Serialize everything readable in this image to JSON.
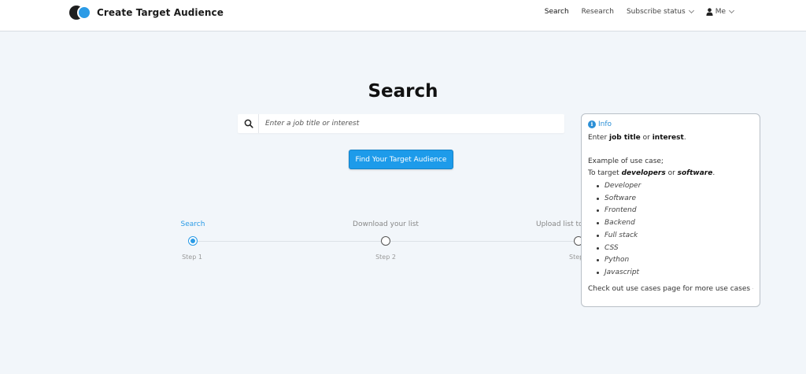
{
  "header": {
    "app_title": "Create Target Audience",
    "nav": {
      "search": "Search",
      "research": "Research",
      "subscribe": "Subscribe status",
      "me": "Me"
    }
  },
  "main": {
    "title": "Search",
    "search_placeholder": "Enter a job title or interest",
    "search_value": "",
    "find_button": "Find Your Target Audience"
  },
  "stepper": {
    "steps": [
      {
        "label": "Search",
        "sub": "Step 1",
        "active": true
      },
      {
        "label": "Download your list",
        "sub": "Step 2",
        "active": false
      },
      {
        "label": "Upload list to",
        "sub": "Step",
        "active": false
      }
    ]
  },
  "info": {
    "heading": "Info",
    "line1_pre": "Enter ",
    "line1_b1": "job title",
    "line1_mid": " or ",
    "line1_b2": "interest",
    "line1_post": ".",
    "example": "Example of use case;",
    "target_pre": "To target ",
    "target_b1": "developers",
    "target_mid": " or ",
    "target_b2": "software",
    "target_post": ".",
    "use_cases": [
      "Developer",
      "Software",
      "Frontend",
      "Backend",
      "Full stack",
      "CSS",
      "Python",
      "Javascript"
    ],
    "more": "Check out use cases page for more use cases"
  },
  "colors": {
    "accent": "#1d9bea",
    "background": "#f2f6fa"
  }
}
